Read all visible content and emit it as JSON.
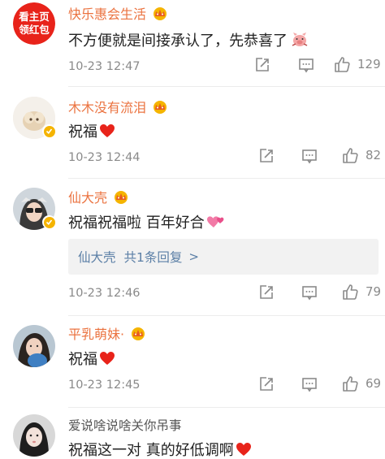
{
  "colors": {
    "vip_name": "#eb7340",
    "reply_link": "#5b7fa6",
    "meta_gray": "#8a8a8a",
    "heart": "#e8231a",
    "promo_bg": "#e8231a"
  },
  "comments": [
    {
      "avatar_type": "promo-badge",
      "avatar_text": [
        "看主页",
        "领红包"
      ],
      "username": "快乐惠会生活",
      "vip": true,
      "text": "不方便就是间接承认了，先恭喜了",
      "emoji": "pig-emoji",
      "time": "10-23 12:47",
      "likes": "129"
    },
    {
      "avatar_type": "photo",
      "username": "木木没有流泪",
      "vip": true,
      "verified": true,
      "text": "祝福",
      "emoji": "heart-icon",
      "time": "10-23 12:44",
      "likes": "82"
    },
    {
      "avatar_type": "photo",
      "username": "仙大壳",
      "vip": true,
      "verified": true,
      "text": "祝福祝福啦 百年好合",
      "emoji": "pink-hearts-icon",
      "reply": {
        "author": "仙大壳",
        "summary": "共1条回复",
        "chevron": ">"
      },
      "time": "10-23 12:46",
      "likes": "79"
    },
    {
      "avatar_type": "photo",
      "username": "平乳萌妹·",
      "vip": true,
      "verified": false,
      "text": "祝福",
      "emoji": "heart-icon",
      "time": "10-23 12:45",
      "likes": "69"
    },
    {
      "avatar_type": "photo",
      "username": "爱说啥说啥关你吊事",
      "vip": false,
      "verified": false,
      "text": "祝福这一对 真的好低调啊",
      "emoji": "heart-icon"
    }
  ]
}
